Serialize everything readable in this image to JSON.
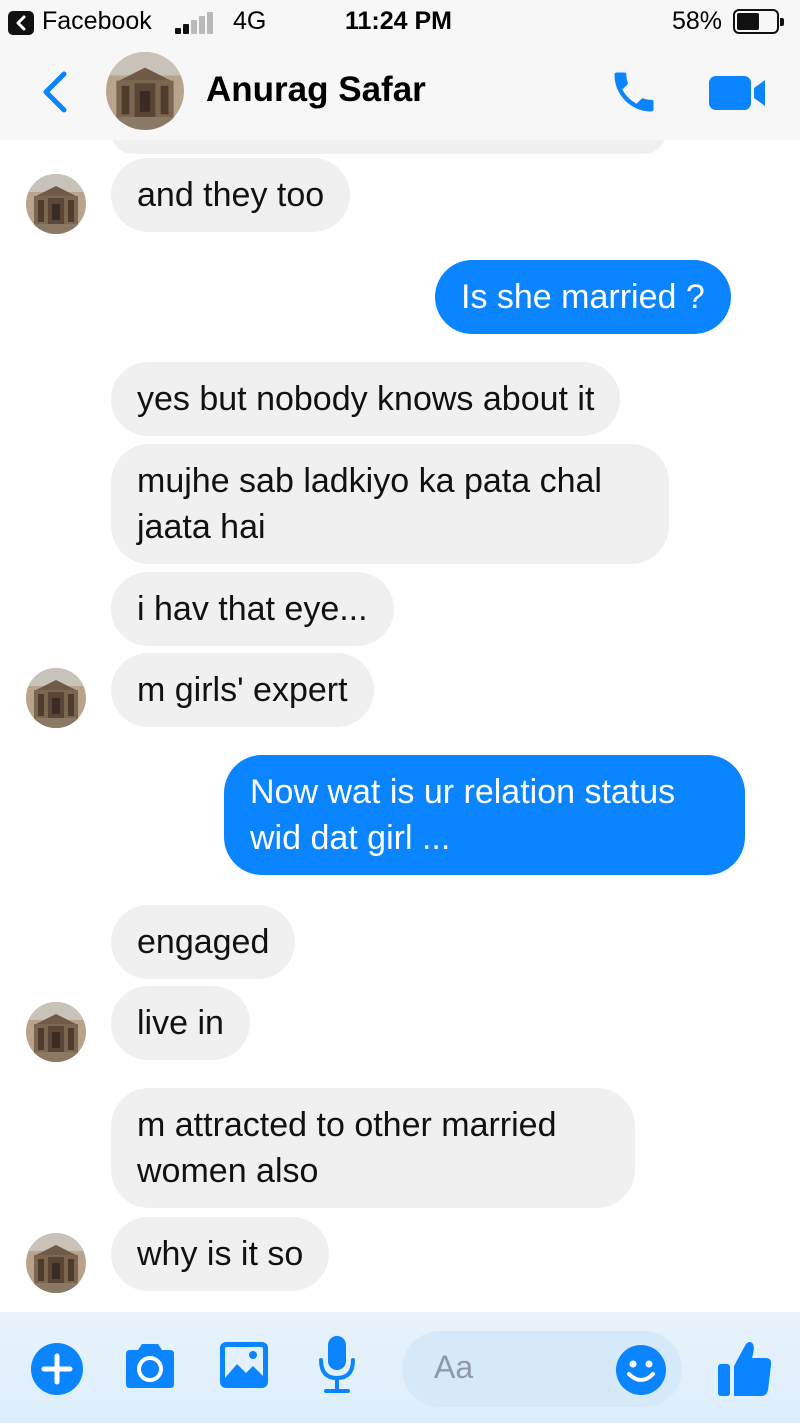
{
  "status_bar": {
    "back_app": "Facebook",
    "network": "4G",
    "time": "11:24 PM",
    "battery_percent": "58%",
    "battery_level": 0.58,
    "signal_bars": 2
  },
  "header": {
    "contact_name": "Anurag Safar"
  },
  "messages": [
    {
      "dir": "in",
      "text": "and they too"
    },
    {
      "dir": "out",
      "text": "Is she married ?"
    },
    {
      "dir": "in",
      "text": "yes  but nobody knows about it"
    },
    {
      "dir": "in",
      "lines": [
        "mujhe sab ladkiyo ka pata chal",
        "jaata hai"
      ]
    },
    {
      "dir": "in",
      "text": "i hav that eye..."
    },
    {
      "dir": "in",
      "text": "m girls' expert"
    },
    {
      "dir": "out",
      "lines": [
        "Now wat is ur relation status",
        "wid dat girl ..."
      ]
    },
    {
      "dir": "in",
      "text": "engaged"
    },
    {
      "dir": "in",
      "text": "live in"
    },
    {
      "dir": "in",
      "lines": [
        "m attracted to other married",
        "women also"
      ]
    },
    {
      "dir": "in",
      "text": "why is it so"
    }
  ],
  "composer": {
    "placeholder": "Aa"
  },
  "colors": {
    "accent": "#0a84ff",
    "incoming_bubble": "#f0f0f0",
    "outgoing_text": "#ffffff"
  },
  "icons": [
    "chevron-left-icon",
    "phone-icon",
    "video-camera-icon",
    "plus-icon",
    "camera-icon",
    "image-icon",
    "microphone-icon",
    "emoji-icon",
    "thumbs-up-icon"
  ]
}
